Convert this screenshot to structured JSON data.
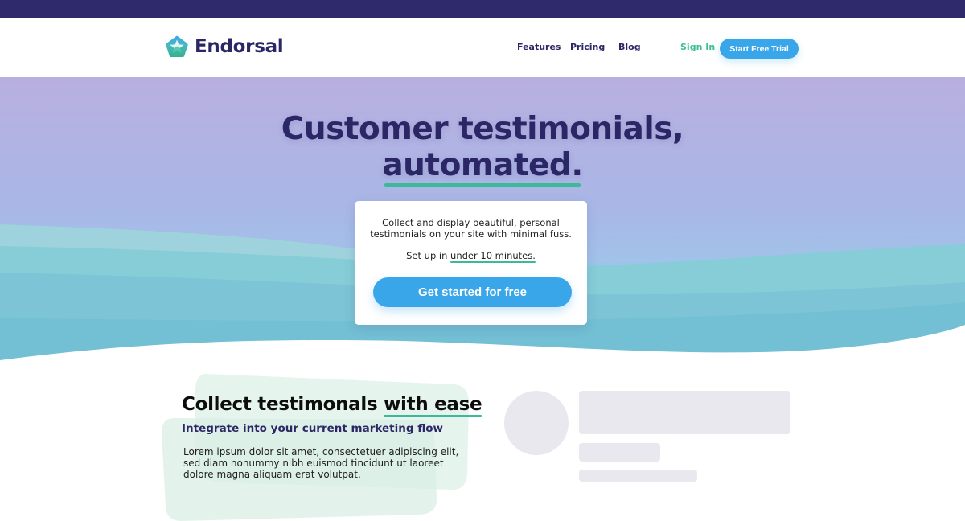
{
  "brand": {
    "name": "Endorsal",
    "logo_icon": "star-pentagon-icon",
    "colors": {
      "primary_dark": "#2b2666",
      "top_bar": "#2f2a6b",
      "accent_blue": "#3aa6ea",
      "accent_green": "#3db89a",
      "link_green": "#3cbf8f"
    }
  },
  "nav": {
    "links": [
      {
        "label": "Features"
      },
      {
        "label": "Pricing"
      },
      {
        "label": "Blog"
      }
    ],
    "sign_in": "Sign In",
    "trial_button": "Start Free Trial"
  },
  "hero": {
    "title_line1": "Customer testimonials,",
    "title_line2": "automated.",
    "card": {
      "description": "Collect and display beautiful, personal testimonials on your site with minimal fuss.",
      "setup_prefix": "Set up in ",
      "setup_highlight": "under 10 minutes.",
      "cta": "Get started for free"
    }
  },
  "feature": {
    "title_prefix": "Collect testimonals ",
    "title_highlight": "with ease",
    "subtitle": "Integrate into your current marketing flow",
    "body": "Lorem ipsum dolor sit amet, consectetuer adipiscing elit, sed diam nonummy nibh euismod tincidunt ut laoreet dolore magna aliquam erat volutpat."
  },
  "preview": {
    "avatar_icon": "avatar-placeholder-icon"
  }
}
